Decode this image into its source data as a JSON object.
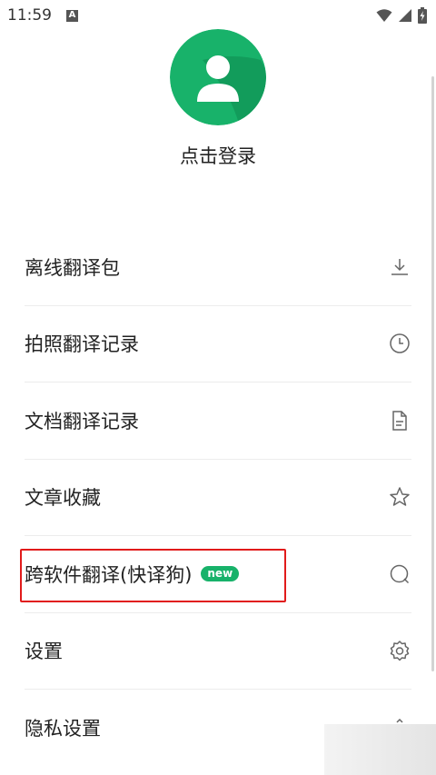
{
  "status_bar": {
    "time": "11:59",
    "notification_letter": "A"
  },
  "profile": {
    "login_label": "点击登录"
  },
  "menu": {
    "items": [
      {
        "label": "离线翻译包",
        "icon": "download-icon"
      },
      {
        "label": "拍照翻译记录",
        "icon": "clock-icon"
      },
      {
        "label": "文档翻译记录",
        "icon": "document-icon"
      },
      {
        "label": "文章收藏",
        "icon": "star-icon"
      },
      {
        "label": "跨软件翻译(快译狗)",
        "icon": "search-bubble-icon",
        "badge": "new"
      },
      {
        "label": "设置",
        "icon": "gear-icon"
      },
      {
        "label": "隐私设置",
        "icon": "chevron-up-icon"
      }
    ]
  },
  "colors": {
    "avatar_green": "#18b26a",
    "badge_green": "#18b26a",
    "highlight_red": "#e11b1b"
  }
}
